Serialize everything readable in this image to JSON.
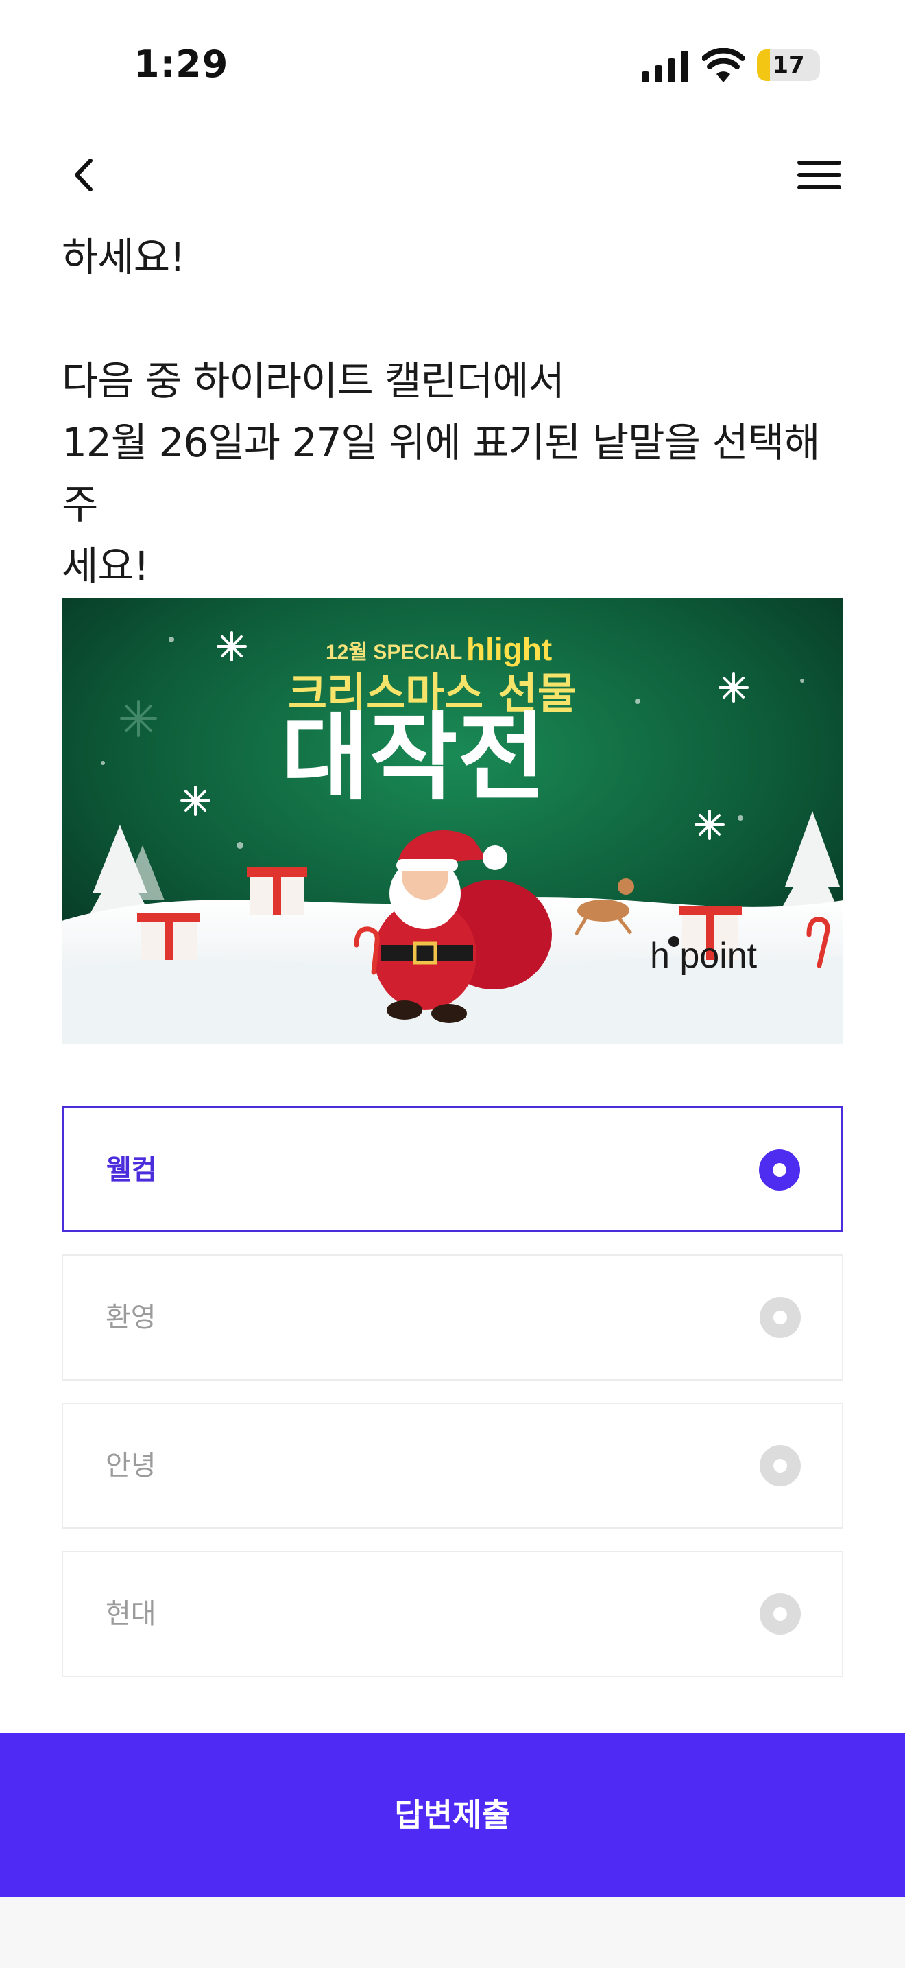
{
  "status": {
    "time": "1:29",
    "battery": "17"
  },
  "question": {
    "line_top": "하세요!",
    "line1": "다음 중 하이라이트 캘린더에서",
    "line2": "12월 26일과 27일 위에 표기된 낱말을 선택해주",
    "line3": "세요!"
  },
  "banner": {
    "top_text": "12월 SPECIAL",
    "brand": "hlight",
    "headline1": "크리스마스 선물",
    "headline2": "대작전",
    "logo": "h point"
  },
  "options": [
    {
      "label": "웰컴",
      "selected": true
    },
    {
      "label": "환영",
      "selected": false
    },
    {
      "label": "안녕",
      "selected": false
    },
    {
      "label": "현대",
      "selected": false
    }
  ],
  "submit_label": "답변제출",
  "colors": {
    "accent": "#4f2af5",
    "selected_border": "#4b2ddc",
    "battery": "#f3c613"
  }
}
